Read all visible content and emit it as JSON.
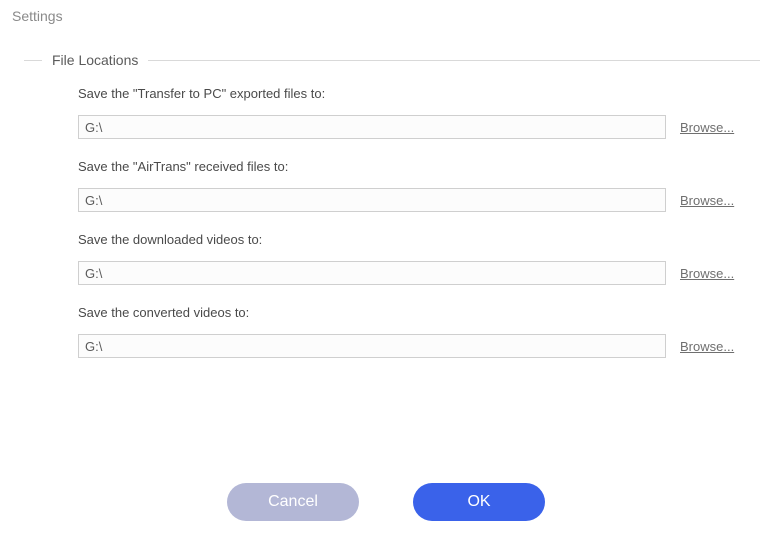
{
  "window": {
    "title": "Settings"
  },
  "section": {
    "title": "File Locations"
  },
  "fields": [
    {
      "label": "Save the \"Transfer to PC\" exported files to:",
      "value": "G:\\",
      "browse": "Browse..."
    },
    {
      "label": "Save the \"AirTrans\" received files to:",
      "value": "G:\\",
      "browse": "Browse..."
    },
    {
      "label": "Save the downloaded videos to:",
      "value": "G:\\",
      "browse": "Browse..."
    },
    {
      "label": "Save the converted videos to:",
      "value": "G:\\",
      "browse": "Browse..."
    }
  ],
  "buttons": {
    "cancel": "Cancel",
    "ok": "OK"
  }
}
